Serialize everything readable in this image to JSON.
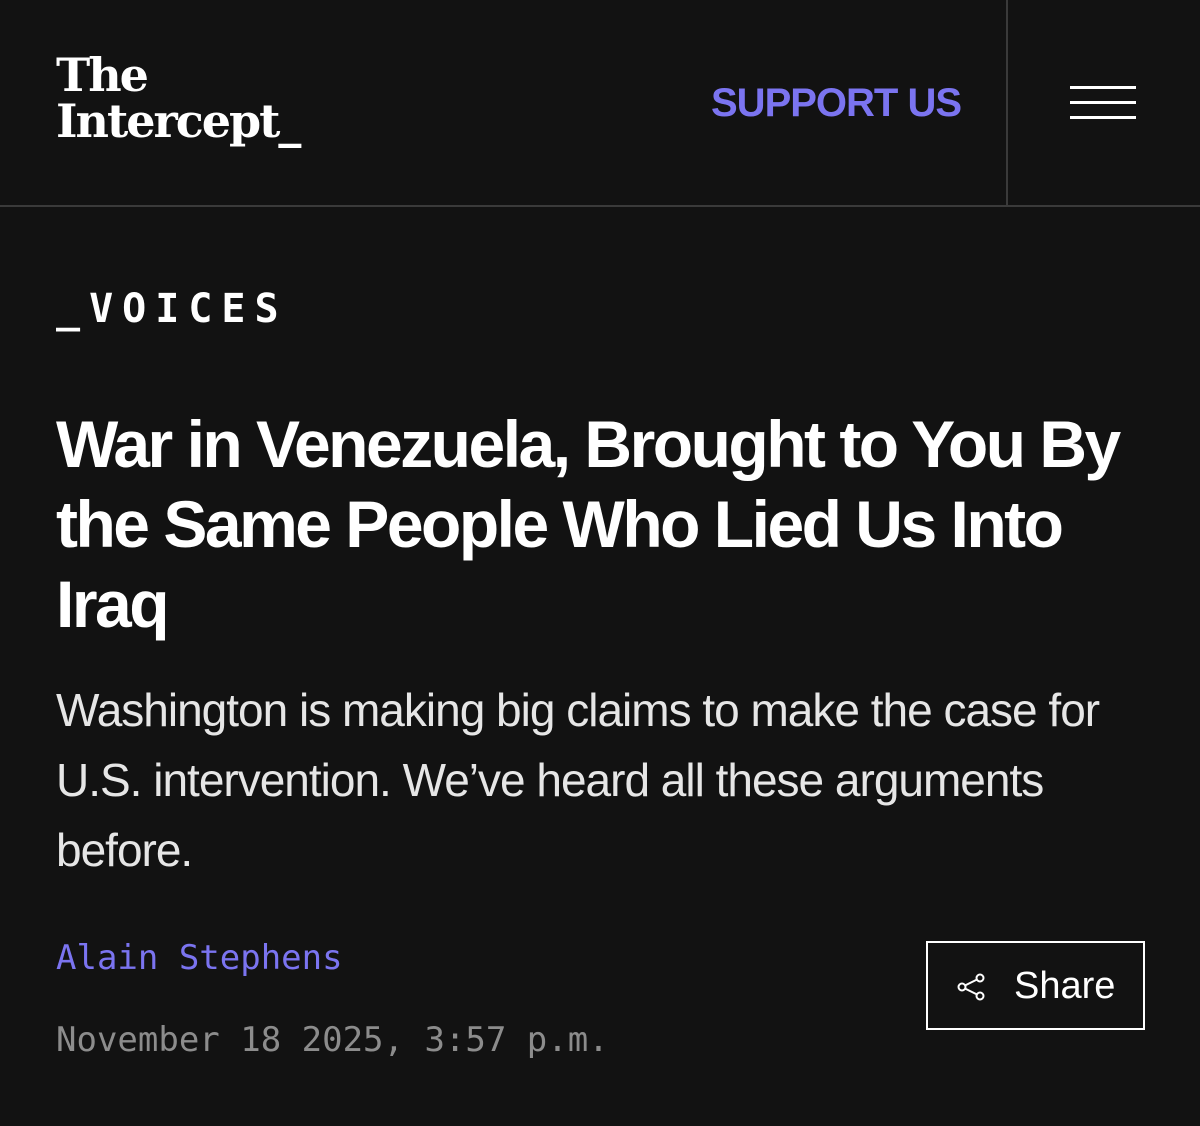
{
  "header": {
    "logo_line1": "The",
    "logo_line2": "Intercept_",
    "support_label": "SUPPORT US",
    "menu_icon": "hamburger-menu-icon"
  },
  "article": {
    "kicker": "_VOICES",
    "headline": "War in Venezuela, Brought to You By the Same People Who Lied Us Into Iraq",
    "dek": "Washington is making big claims to make the case for U.S. intervention. We’ve heard all these arguments before.",
    "author": "Alain Stephens",
    "date": "November 18 2025, 3:57 p.m."
  },
  "share": {
    "label": "Share",
    "icon": "share-icon"
  },
  "colors": {
    "background": "#121212",
    "accent": "#7b74f0",
    "text": "#ffffff",
    "muted": "#8c8c8c",
    "divider": "#3a3a3a"
  }
}
